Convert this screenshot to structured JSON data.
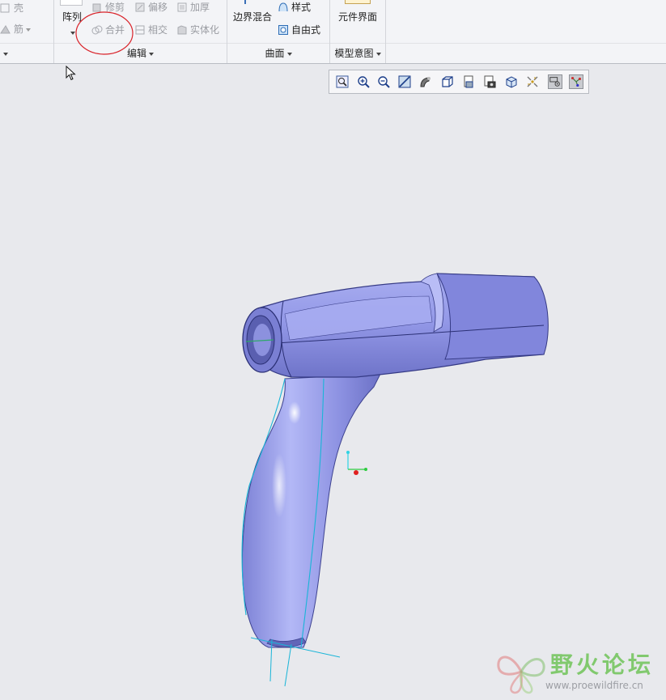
{
  "ribbon": {
    "shell_label": "壳",
    "rib_label": "筋",
    "pattern_label": "阵列",
    "trim_label": "修剪",
    "offset_label": "偏移",
    "thicken_label": "加厚",
    "merge_label": "合并",
    "intersect_label": "相交",
    "solidify_label": "实体化",
    "edit_group": "编辑",
    "boundary_blend_label": "边界混合",
    "style_label": "样式",
    "freestyle_label": "自由式",
    "surface_group": "曲面",
    "component_interface_label": "元件界面",
    "model_intent_group": "模型意图"
  },
  "view_toolbar": {
    "buttons": [
      "refit-icon",
      "zoom-in-icon",
      "zoom-out-icon",
      "repaint-icon",
      "display-style-icon",
      "saved-orientations-icon",
      "saved-views-icon",
      "view-manager-icon",
      "perspective-icon",
      "annotation-display-icon",
      "datum-display-icon",
      "spin-center-icon"
    ]
  },
  "watermark": {
    "site_name": "野火论坛",
    "site_url": "www.proewildfire.cn"
  },
  "colors": {
    "model_fill": "#8f95e6",
    "highlight_edge": "#19b5d8",
    "annotation_circle": "#d9232a",
    "watermark_green": "#5fbf44"
  }
}
